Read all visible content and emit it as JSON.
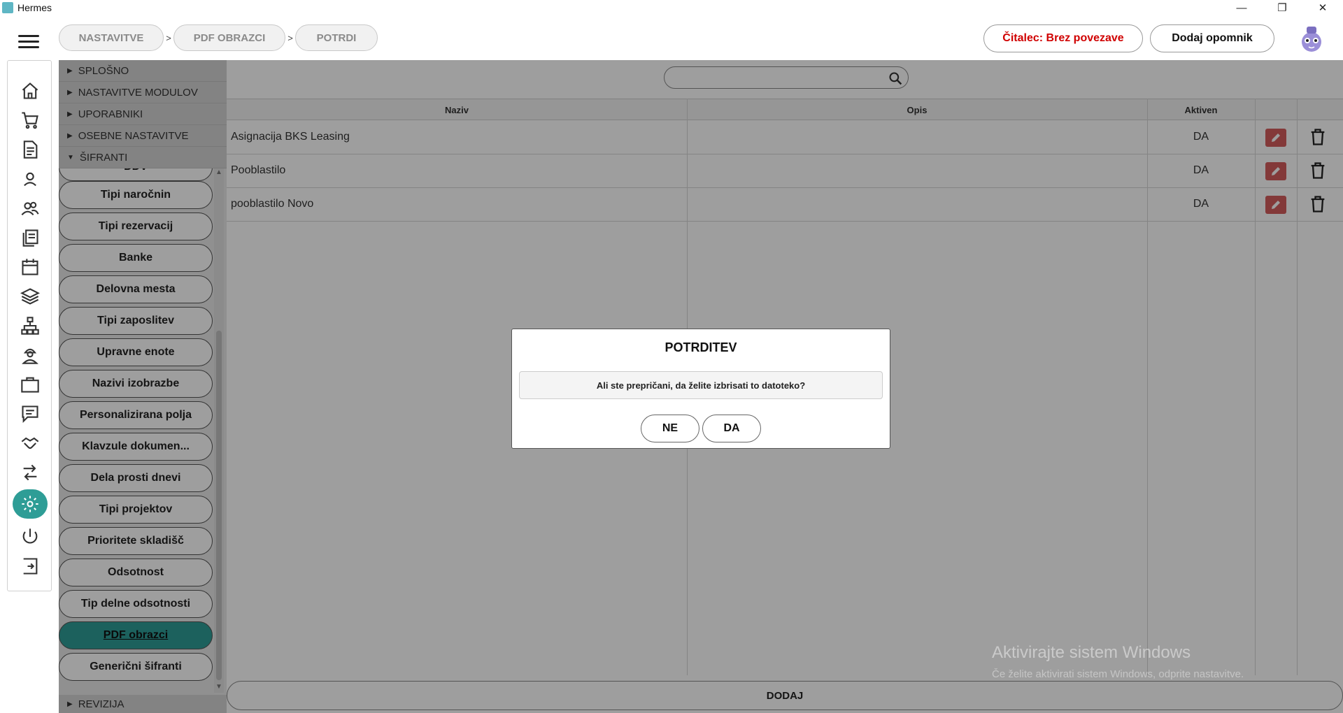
{
  "window": {
    "title": "Hermes",
    "controls": [
      "—",
      "❐",
      "✕"
    ]
  },
  "breadcrumb": [
    "NASTAVITVE",
    "PDF OBRAZCI",
    "POTRDI"
  ],
  "breadcrumb_sep": ">",
  "header": {
    "reader_status": "Čitalec: Brez povezave",
    "add_reminder": "Dodaj opomnik"
  },
  "tree": {
    "sections": [
      "SPLOŠNO",
      "NASTAVITVE MODULOV",
      "UPORABNIKI",
      "OSEBNE NASTAVITVE",
      "ŠIFRANTI"
    ],
    "items": [
      "DDV",
      "Tipi naročnin",
      "Tipi rezervacij",
      "Banke",
      "Delovna mesta",
      "Tipi zaposlitev",
      "Upravne enote",
      "Nazivi izobrazbe",
      "Personalizirana polja",
      "Klavzule dokumen...",
      "Dela prosti dnevi",
      "Tipi projektov",
      "Prioritete skladišč",
      "Odsotnost",
      "Tip delne odsotnosti",
      "PDF obrazci",
      "Generični šifranti"
    ],
    "selected": "PDF obrazci",
    "footer": "REVIZIJA"
  },
  "table": {
    "columns": [
      "Naziv",
      "Opis",
      "Aktiven"
    ],
    "rows": [
      {
        "naziv": "Asignacija BKS Leasing",
        "opis": "",
        "aktiven": "DA"
      },
      {
        "naziv": "Pooblastilo",
        "opis": "",
        "aktiven": "DA"
      },
      {
        "naziv": "pooblastilo Novo",
        "opis": "",
        "aktiven": "DA"
      }
    ],
    "add_label": "DODAJ"
  },
  "dialog": {
    "title": "POTRDITEV",
    "message": "Ali ste prepričani, da želite izbrisati to datoteko?",
    "no": "NE",
    "yes": "DA"
  },
  "watermark": {
    "line1": "Aktivirajte sistem Windows",
    "line2": "Če želite aktivirati sistem Windows, odprite nastavitve."
  },
  "colors": {
    "accent": "#2e9d96",
    "reader_status": "#d00000",
    "edit_button": "#d45d5d"
  }
}
